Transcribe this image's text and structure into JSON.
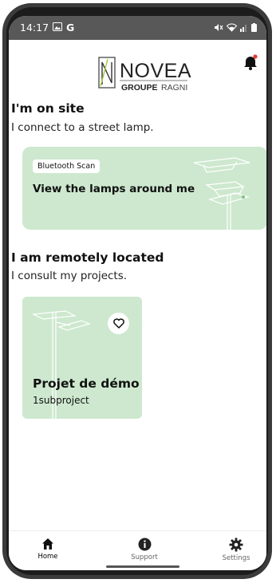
{
  "status_bar": {
    "time": "14:17",
    "left_icons": [
      "image-icon",
      "google-g-icon"
    ],
    "right_icons": [
      "mute-icon",
      "wifi-icon",
      "signal-icon",
      "battery-icon"
    ]
  },
  "header": {
    "logo_brand": "NOVEA",
    "logo_group": "GROUPE",
    "logo_group_name": "RAGNI",
    "notification_dot_color": "#e53935"
  },
  "on_site": {
    "title": "I'm on site",
    "subtitle": "I connect to a street lamp."
  },
  "scan_card": {
    "badge": "Bluetooth Scan",
    "title": "View the lamps around me"
  },
  "remote": {
    "title": "I am remotely located",
    "subtitle": "I consult my projects."
  },
  "projects": [
    {
      "name": "Projet de démo",
      "subprojects": "1subproject"
    }
  ],
  "bottom_nav": [
    {
      "label": "Home",
      "icon": "home-icon",
      "active": true
    },
    {
      "label": "Support",
      "icon": "info-icon",
      "active": false
    },
    {
      "label": "Settings",
      "icon": "gear-icon",
      "active": false
    }
  ],
  "colors": {
    "card_green": "#cde8ce",
    "status_bar": "#585858"
  }
}
